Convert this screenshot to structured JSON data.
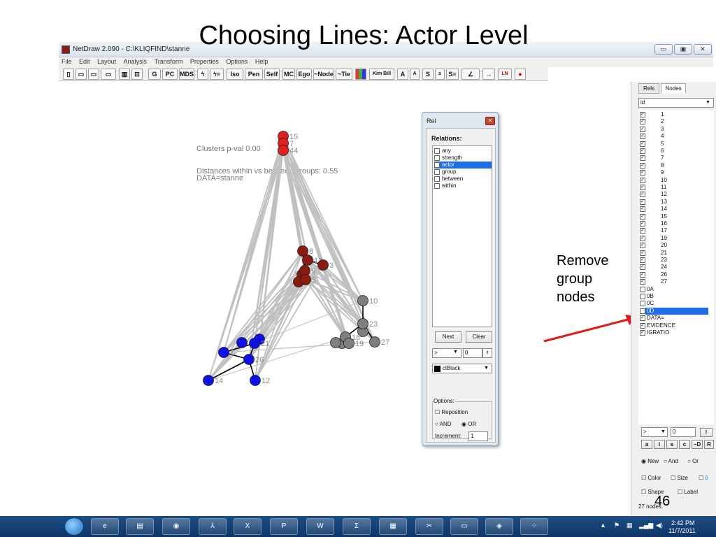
{
  "slide": {
    "title": "Choosing Lines: Actor Level",
    "page_number": "46"
  },
  "window": {
    "title": "NetDraw 2.090 - C:\\KLIQFIND\\stanne",
    "controls": [
      "minimize-icon",
      "maximize-icon",
      "close-icon"
    ],
    "control_glyphs": [
      "▭",
      "▣",
      "✕"
    ]
  },
  "menu": [
    "File",
    "Edit",
    "Layout",
    "Analysis",
    "Transform",
    "Properties",
    "Options",
    "Help"
  ],
  "toolbar": [
    "G",
    "PC",
    "MDS",
    "ϟ",
    "ϟ=",
    "Iso",
    "Pen",
    "Self",
    "MC",
    "Ego",
    "~Node",
    "~Tie",
    "Kim Bill",
    "A",
    "A",
    "S",
    "s",
    "S=",
    "∠",
    "→",
    "LN",
    "●"
  ],
  "graph": {
    "info_lines": [
      "Clusters p-val    0.00",
      "Distances within vs between groups:   0.55",
      "DATA=stanne"
    ],
    "colors": {
      "red": "#e01f1f",
      "darkred": "#8b1a10",
      "blue": "#1010e8",
      "gray": "#7f7f7f",
      "edge": "#c0c0c0",
      "tie": "#000000"
    },
    "nodes": [
      {
        "label": "15",
        "group": "red"
      },
      {
        "label": "7",
        "group": "red"
      },
      {
        "label": "44",
        "group": "red"
      },
      {
        "label": "8",
        "group": "darkred"
      },
      {
        "label": "13",
        "group": "darkred"
      },
      {
        "label": "3",
        "group": "darkred"
      },
      {
        "label": "9",
        "group": "darkred"
      },
      {
        "label": "5",
        "group": "darkred"
      },
      {
        "label": "10",
        "group": "gray"
      },
      {
        "label": "23",
        "group": "gray"
      },
      {
        "label": "16",
        "group": "gray"
      },
      {
        "label": "19",
        "group": "gray"
      },
      {
        "label": "27",
        "group": "gray"
      },
      {
        "label": "1",
        "group": "blue"
      },
      {
        "label": "21",
        "group": "blue"
      },
      {
        "label": "26",
        "group": "blue"
      },
      {
        "label": "14",
        "group": "blue"
      },
      {
        "label": "12",
        "group": "blue"
      }
    ]
  },
  "rel_dialog": {
    "title": "Rel",
    "close_glyph": "✕",
    "heading": "Relations:",
    "items": [
      {
        "label": "any",
        "checked": false,
        "selected": false
      },
      {
        "label": "strength",
        "checked": false,
        "selected": false
      },
      {
        "label": "actor",
        "checked": true,
        "selected": true
      },
      {
        "label": "group",
        "checked": false,
        "selected": false
      },
      {
        "label": "between",
        "checked": false,
        "selected": false
      },
      {
        "label": "within",
        "checked": false,
        "selected": false
      }
    ],
    "next_button": "Next",
    "clear_button": "Clear",
    "operator": ">",
    "operator_value": "0",
    "color_value": "clBlack",
    "options_label": "Options:",
    "reposition_label": "Reposition",
    "and_label": "AND",
    "or_label": "OR",
    "increment_label": "Increment:",
    "increment_value": "1"
  },
  "nodes_panel": {
    "tabs": [
      "Rels",
      "Nodes"
    ],
    "active_tab": "Nodes",
    "attribute": "id",
    "items": [
      {
        "label": "1",
        "checked": true
      },
      {
        "label": "2",
        "checked": true
      },
      {
        "label": "3",
        "checked": true
      },
      {
        "label": "4",
        "checked": true
      },
      {
        "label": "5",
        "checked": true
      },
      {
        "label": "6",
        "checked": true
      },
      {
        "label": "7",
        "checked": true
      },
      {
        "label": "8",
        "checked": true
      },
      {
        "label": "9",
        "checked": true
      },
      {
        "label": "10",
        "checked": true
      },
      {
        "label": "11",
        "checked": true
      },
      {
        "label": "12",
        "checked": true
      },
      {
        "label": "13",
        "checked": true
      },
      {
        "label": "14",
        "checked": true
      },
      {
        "label": "15",
        "checked": true
      },
      {
        "label": "16",
        "checked": true
      },
      {
        "label": "17",
        "checked": true
      },
      {
        "label": "19",
        "checked": true
      },
      {
        "label": "20",
        "checked": true
      },
      {
        "label": "21",
        "checked": true
      },
      {
        "label": "23",
        "checked": true
      },
      {
        "label": "24",
        "checked": true
      },
      {
        "label": "26",
        "checked": true
      },
      {
        "label": "27",
        "checked": true
      },
      {
        "label": "0A",
        "checked": false
      },
      {
        "label": "0B",
        "checked": false
      },
      {
        "label": "0C",
        "checked": false
      },
      {
        "label": "0D",
        "checked": false,
        "selected": true
      },
      {
        "label": "DATA=",
        "checked": true
      },
      {
        "label": "EVIDENCE",
        "checked": true
      },
      {
        "label": "IGRATIO",
        "checked": true
      }
    ],
    "operator": ">",
    "operator_value": "0",
    "exclaim": "!",
    "buttons": [
      "a",
      "i",
      "s",
      "c",
      "~D",
      "R"
    ],
    "new_label": "New",
    "and_label": "And",
    "or_label": "Or",
    "color_label": "Color",
    "size_label": "Size",
    "size_value": "0",
    "shape_label": "Shape",
    "label_label": "Label",
    "status": "27 nodes."
  },
  "annotation": {
    "lines": [
      "Remove",
      "group",
      "nodes"
    ],
    "arrow_color": "#e01a1a"
  },
  "taskbar": {
    "items": [
      "ie-icon",
      "explorer-icon",
      "firefox-icon",
      "acrobat-icon",
      "excel-icon",
      "powerpoint-icon",
      "word-icon",
      "calc-icon",
      "netdraw-icon",
      "snipping-icon",
      "folder-icon",
      "tool-icon",
      "network-icon"
    ],
    "glyphs": [
      "e",
      "▤",
      "◉",
      "⅄",
      "X",
      "P",
      "W",
      "Σ",
      "▦",
      "✂",
      "▭",
      "◈",
      "⁘"
    ],
    "time": "2:42 PM",
    "date": "11/7/2011"
  }
}
